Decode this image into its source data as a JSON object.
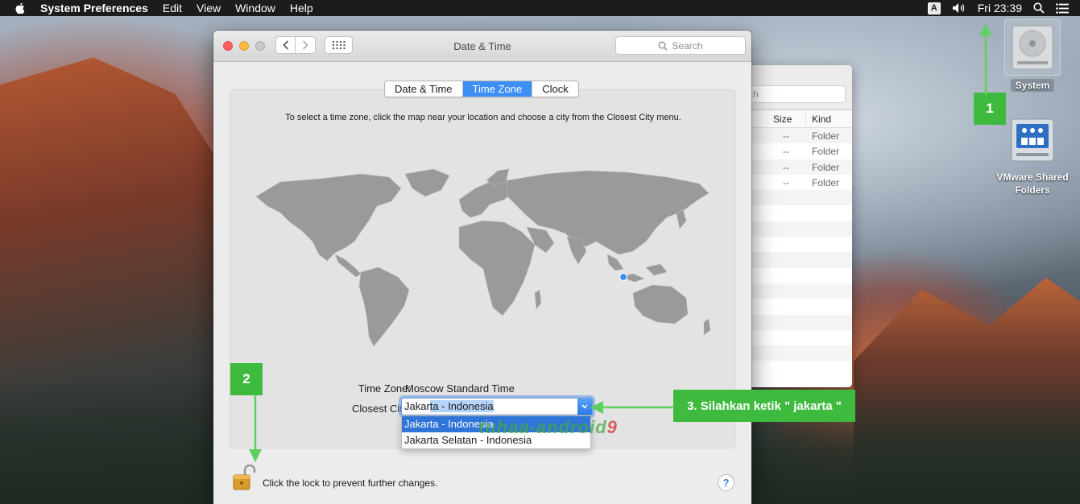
{
  "menubar": {
    "app_name": "System Preferences",
    "items": [
      "Edit",
      "View",
      "Window",
      "Help"
    ],
    "input_source": "A",
    "clock": "Fri 23:39"
  },
  "desktop": {
    "system_label": "System",
    "vmware_label_1": "VMware Shared",
    "vmware_label_2": "Folders"
  },
  "finder": {
    "search_fragment": "ch",
    "col_size": "Size",
    "col_kind": "Kind",
    "rows": [
      {
        "size": "--",
        "kind": "Folder"
      },
      {
        "size": "--",
        "kind": "Folder"
      },
      {
        "size": "--",
        "kind": "Folder"
      },
      {
        "size": "--",
        "kind": "Folder"
      }
    ]
  },
  "window": {
    "title": "Date & Time",
    "search_placeholder": "Search"
  },
  "tabs": [
    {
      "label": "Date & Time",
      "active": false
    },
    {
      "label": "Time Zone",
      "active": true
    },
    {
      "label": "Clock",
      "active": false
    }
  ],
  "timezone": {
    "instructions": "To select a time zone, click the map near your location and choose a city from the Closest City menu.",
    "tz_label": "Time Zone:",
    "tz_value": "Moscow Standard Time",
    "city_label": "Closest City:",
    "typed_prefix": "Jakar",
    "typed_selected": "ta - Indonesia",
    "options": [
      "Jakarta - Indonesia",
      "Jakarta Selatan - Indonesia"
    ]
  },
  "footer": {
    "lock_text": "Click the lock to prevent further changes.",
    "help_label": "?"
  },
  "annotations": {
    "badge_1": "1",
    "badge_2": "2",
    "badge_3": "3. Silahkan ketik \" jakarta \"",
    "watermark_a": "tuhaa-",
    "watermark_b": "android",
    "watermark_c": "9"
  },
  "colors": {
    "accent": "#3d8ef5",
    "annotation_green": "#3eba3e",
    "selection": "#2f74d8"
  }
}
